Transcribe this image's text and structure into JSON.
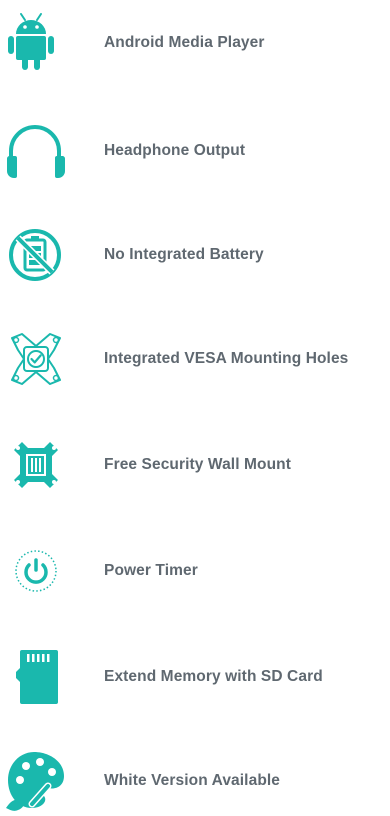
{
  "features": [
    {
      "label": "Android Media Player",
      "icon": "android-icon"
    },
    {
      "label": "Headphone Output",
      "icon": "headphones-icon"
    },
    {
      "label": "No Integrated Battery",
      "icon": "no-battery-icon"
    },
    {
      "label": "Integrated VESA Mounting Holes",
      "icon": "vesa-mount-icon"
    },
    {
      "label": "Free Security Wall Mount",
      "icon": "wall-mount-icon"
    },
    {
      "label": "Power Timer",
      "icon": "power-timer-icon"
    },
    {
      "label": "Extend Memory with SD Card",
      "icon": "sd-card-icon"
    },
    {
      "label": "White Version Available",
      "icon": "palette-icon"
    }
  ],
  "colors": {
    "icon": "#1ab8ad",
    "text": "#5f6870",
    "background": "#ffffff"
  }
}
